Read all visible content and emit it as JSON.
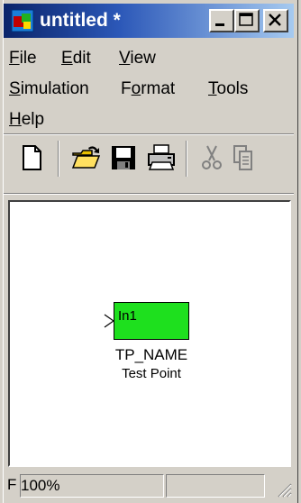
{
  "window": {
    "title": "untitled *"
  },
  "menu": {
    "file": "File",
    "edit": "Edit",
    "view": "View",
    "simulation": "Simulation",
    "format": "Format",
    "tools": "Tools",
    "help": "Help"
  },
  "toolbar": {
    "buttons": [
      "new-icon",
      "open-icon",
      "save-icon",
      "print-icon",
      "cut-icon",
      "copy-icon"
    ]
  },
  "block": {
    "port_label": "In1",
    "name": "TP_NAME",
    "description": "Test Point",
    "color": "#1ee01e"
  },
  "status": {
    "left_text": "F",
    "zoom": "100%"
  },
  "colors": {
    "titlebar_start": "#0a246a",
    "titlebar_end": "#a6caf0",
    "chrome": "#d4d0c8"
  }
}
